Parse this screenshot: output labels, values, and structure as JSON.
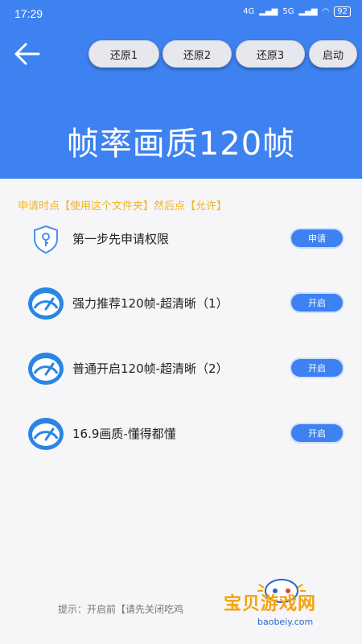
{
  "status": {
    "time": "17:29",
    "signal1": "4G",
    "signal2": "5G",
    "battery": "92"
  },
  "header": {
    "back_icon": "arrow-left-icon",
    "buttons": [
      "还原1",
      "还原2",
      "还原3",
      "启动"
    ],
    "title": "帧率画质120帧"
  },
  "notice": "申请时点【使用这个文件夹】然后点【允许】",
  "rows": [
    {
      "icon": "shield-key-icon",
      "label": "第一步先申请权限",
      "button": "申请"
    },
    {
      "icon": "speedometer-icon",
      "label": "强力推荐120帧-超清晰（1）",
      "button": "开启"
    },
    {
      "icon": "speedometer-icon",
      "label": "普通开启120帧-超清晰（2）",
      "button": "开启"
    },
    {
      "icon": "speedometer-icon",
      "label": "16.9画质-懂得都懂",
      "button": "开启"
    }
  ],
  "tip": "提示：开启前【请先关闭吃鸡",
  "watermark": {
    "text": "宝贝游戏网",
    "url": "baobeiy.com"
  },
  "colors": {
    "primary": "#3e82f1",
    "notice": "#f1b424"
  }
}
